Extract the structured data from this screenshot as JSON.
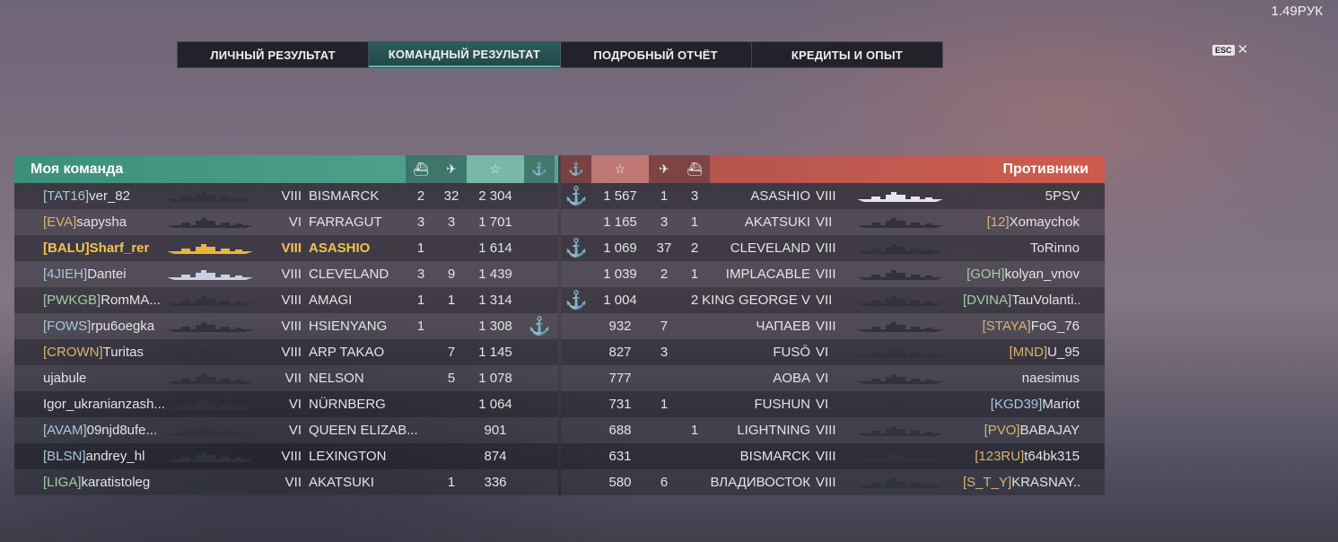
{
  "version": "1.49PУК",
  "tabs": [
    {
      "label": "ЛИЧНЫЙ РЕЗУЛЬТАТ",
      "active": false
    },
    {
      "label": "КОМАНДНЫЙ РЕЗУЛЬТАТ",
      "active": true
    },
    {
      "label": "ПОДРОБНЫЙ ОТЧЁТ",
      "active": false
    },
    {
      "label": "КРЕДИТЫ И ОПЫТ",
      "active": false
    }
  ],
  "esc_label": "ESC",
  "close_glyph": "✕",
  "header_icons": {
    "ship_kill": "⛴",
    "plane_kill": "✈",
    "score": "☆",
    "base": "⚓"
  },
  "my_team": {
    "title": "Моя команда",
    "rows": [
      {
        "clan": "[TAT16]",
        "name": "ver_82",
        "tier": "VIII",
        "ship": "BISMARCK",
        "ships": "2",
        "planes": "32",
        "score": "2 304",
        "anchor": false,
        "me": false
      },
      {
        "clan": "[EVA]",
        "name": "sapysha",
        "tier": "VI",
        "ship": "FARRAGUT",
        "ships": "3",
        "planes": "3",
        "score": "1 701",
        "anchor": false,
        "me": false
      },
      {
        "clan": "[BALU]",
        "name": "Sharf_rer",
        "tier": "VIII",
        "ship": "ASASHIO",
        "ships": "1",
        "planes": "",
        "score": "1 614",
        "anchor": false,
        "me": true
      },
      {
        "clan": "[4JIEH]",
        "name": "Dantei",
        "tier": "VIII",
        "ship": "CLEVELAND",
        "ships": "3",
        "planes": "9",
        "score": "1 439",
        "anchor": false,
        "me": false
      },
      {
        "clan": "[PWKGB]",
        "name": "RomMA...",
        "tier": "VIII",
        "ship": "AMAGI",
        "ships": "1",
        "planes": "1",
        "score": "1 314",
        "anchor": false,
        "me": false
      },
      {
        "clan": "[FOWS]",
        "name": "rpu6oegka",
        "tier": "VIII",
        "ship": "HSIENYANG",
        "ships": "1",
        "planes": "",
        "score": "1 308",
        "anchor": true,
        "me": false
      },
      {
        "clan": "[CROWN]",
        "name": "Turitas",
        "tier": "VIII",
        "ship": "ARP TAKAO",
        "ships": "",
        "planes": "7",
        "score": "1 145",
        "anchor": false,
        "me": false
      },
      {
        "clan": "",
        "name": "ujabule",
        "tier": "VII",
        "ship": "NELSON",
        "ships": "",
        "planes": "5",
        "score": "1 078",
        "anchor": false,
        "me": false
      },
      {
        "clan": "",
        "name": "Igor_ukranianzash...",
        "tier": "VI",
        "ship": "NÜRNBERG",
        "ships": "",
        "planes": "",
        "score": "1 064",
        "anchor": false,
        "me": false
      },
      {
        "clan": "[AVAM]",
        "name": "09njd8ufe...",
        "tier": "VI",
        "ship": "QUEEN ELIZAB...",
        "ships": "",
        "planes": "",
        "score": "901",
        "anchor": false,
        "me": false
      },
      {
        "clan": "[BLSN]",
        "name": "andrey_hl",
        "tier": "VIII",
        "ship": "LEXINGTON",
        "ships": "",
        "planes": "",
        "score": "874",
        "anchor": false,
        "me": false
      },
      {
        "clan": "[LIGA]",
        "name": "karatistoleg",
        "tier": "VII",
        "ship": "AKATSUKI",
        "ships": "",
        "planes": "1",
        "score": "336",
        "anchor": false,
        "me": false
      }
    ]
  },
  "enemy_team": {
    "title": "Противники",
    "rows": [
      {
        "clan": "",
        "name": "5PSV",
        "tier": "VIII",
        "ship": "ASASHIO",
        "ships": "3",
        "planes": "1",
        "score": "1 567",
        "anchor": true
      },
      {
        "clan": "[12]",
        "name": "Xomaychok",
        "tier": "VII",
        "ship": "AKATSUKI",
        "ships": "1",
        "planes": "3",
        "score": "1 165",
        "anchor": false
      },
      {
        "clan": "",
        "name": "ToRinno",
        "tier": "VIII",
        "ship": "CLEVELAND",
        "ships": "2",
        "planes": "37",
        "score": "1 069",
        "anchor": true
      },
      {
        "clan": "[GOH]",
        "name": "kolyan_vnov",
        "tier": "VIII",
        "ship": "IMPLACABLE",
        "ships": "1",
        "planes": "2",
        "score": "1 039",
        "anchor": false
      },
      {
        "clan": "[DVINA]",
        "name": "TauVolanti...",
        "tier": "VII",
        "ship": "KING GEORGE V",
        "ships": "2",
        "planes": "",
        "score": "1 004",
        "anchor": true
      },
      {
        "clan": "[STAYA]",
        "name": "FoG_76",
        "tier": "VIII",
        "ship": "ЧАПАЕВ",
        "ships": "",
        "planes": "7",
        "score": "932",
        "anchor": false
      },
      {
        "clan": "[MND]",
        "name": "U_95",
        "tier": "VI",
        "ship": "FUSŌ",
        "ships": "",
        "planes": "3",
        "score": "827",
        "anchor": false
      },
      {
        "clan": "",
        "name": "naesimus",
        "tier": "VI",
        "ship": "AOBA",
        "ships": "",
        "planes": "",
        "score": "777",
        "anchor": false
      },
      {
        "clan": "[KGD39]",
        "name": "Mariot",
        "tier": "VI",
        "ship": "FUSHUN",
        "ships": "",
        "planes": "1",
        "score": "731",
        "anchor": false
      },
      {
        "clan": "[PVO]",
        "name": "BABAJAY",
        "tier": "VIII",
        "ship": "LIGHTNING",
        "ships": "1",
        "planes": "",
        "score": "688",
        "anchor": false
      },
      {
        "clan": "[123RU]",
        "name": "t64bk315",
        "tier": "VIII",
        "ship": "BISMARCK",
        "ships": "",
        "planes": "",
        "score": "631",
        "anchor": false
      },
      {
        "clan": "[S_T_Y]",
        "name": "KRASNAY...",
        "tier": "VIII",
        "ship": "ВЛАДИВОСТОК",
        "ships": "",
        "planes": "6",
        "score": "580",
        "anchor": false
      }
    ]
  }
}
